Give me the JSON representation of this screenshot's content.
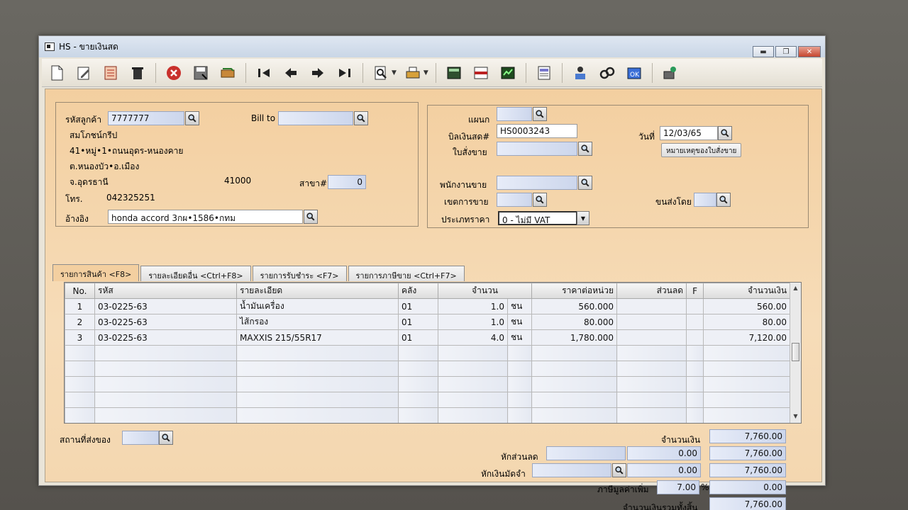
{
  "window": {
    "title": "HS - ขายเงินสด",
    "buttons": {
      "minimize": "▬",
      "maximize": "❐",
      "close": "✕"
    }
  },
  "toolbar": {
    "icons": [
      "new-icon",
      "edit-icon",
      "cancel-doc-icon",
      "trash-icon",
      "close-circle-icon",
      "save-icon",
      "transfer-icon",
      "first-icon",
      "prev-icon",
      "next-icon",
      "last-icon",
      "search-icon",
      "print-icon",
      "calculator-icon",
      "receipt-icon",
      "ledger-icon",
      "report-icon",
      "approve-icon",
      "link-icon",
      "ok-icon",
      "user-settings-icon"
    ]
  },
  "customer": {
    "code_label": "รหัสลูกค้า",
    "code": "7777777",
    "bill_to_label": "Bill to",
    "bill_to": "",
    "name": "สมโภชน์กรีป",
    "address1": "41•หมู่•1•ถนนอุดร-หนองคาย",
    "address2": "ต.หนองบัว•อ.เมือง",
    "province": "จ.อุดรธานี",
    "zip": "41000",
    "branch_label": "สาขา#",
    "branch": "0",
    "phone_label": "โทร.",
    "phone": "042325251",
    "ref_label": "อ้างอิง",
    "ref": "honda accord 3กผ•1586•กทม"
  },
  "doc": {
    "dept_label": "แผนก",
    "dept": "",
    "invoice_label": "บิลเงินสด#",
    "invoice": "HS0003243",
    "date_label": "วันที่",
    "date": "12/03/65",
    "order_label": "ใบสั่งขาย",
    "order": "",
    "note_button": "หมายเหตุของใบสั่งขาย",
    "salesman_label": "พนักงานขาย",
    "salesman": "",
    "area_label": "เขตการขาย",
    "area": "",
    "shipby_label": "ขนส่งโดย",
    "shipby": "",
    "pricetype_label": "ประเภทราคา",
    "pricetype": "0 - ไม่มี VAT"
  },
  "tabs": [
    "รายการสินค้า <F8>",
    "รายละเอียดอื่น <Ctrl+F8>",
    "รายการรับชำระ <F7>",
    "รายการภาษีขาย <Ctrl+F7>"
  ],
  "grid": {
    "headers": [
      "No.",
      "รหัส",
      "รายละเอียด",
      "คลัง",
      "จำนวน",
      "",
      "ราคาต่อหน่วย",
      "ส่วนลด",
      "F",
      "จำนวนเงิน"
    ],
    "rows": [
      [
        "1",
        "03-0225-63",
        "น้ำมันเครื่อง",
        "01",
        "1.0",
        "ชน",
        "560.000",
        "",
        "",
        "560.00"
      ],
      [
        "2",
        "03-0225-63",
        "ไส้กรอง",
        "01",
        "1.0",
        "ชน",
        "80.000",
        "",
        "",
        "80.00"
      ],
      [
        "3",
        "03-0225-63",
        "MAXXIS 215/55R17",
        "01",
        "4.0",
        "ชน",
        "1,780.000",
        "",
        "",
        "7,120.00"
      ]
    ]
  },
  "footer": {
    "ship_place_label": "สถานที่ส่งของ",
    "ship_place": "",
    "amount_label": "จำนวนเงิน",
    "amount": "7,760.00",
    "discount_label": "หักส่วนลด",
    "discount_code": "",
    "discount": "0.00",
    "after_discount": "7,760.00",
    "deposit_label": "หักเงินมัดจำ",
    "deposit_code": "",
    "deposit": "0.00",
    "after_deposit": "7,760.00",
    "vat_label": "ภาษีมูลค่าเพิ่ม",
    "vat_rate": "7.00",
    "vat_pct": "%",
    "vat": "0.00",
    "total_label": "จำนวนเงินรวมทั้งสิ้น",
    "total": "7,760.00"
  },
  "colors": {
    "panel": "#f3cfa0",
    "field_blue": "#ccd6ec",
    "titlebar": "#c9d6e6"
  }
}
